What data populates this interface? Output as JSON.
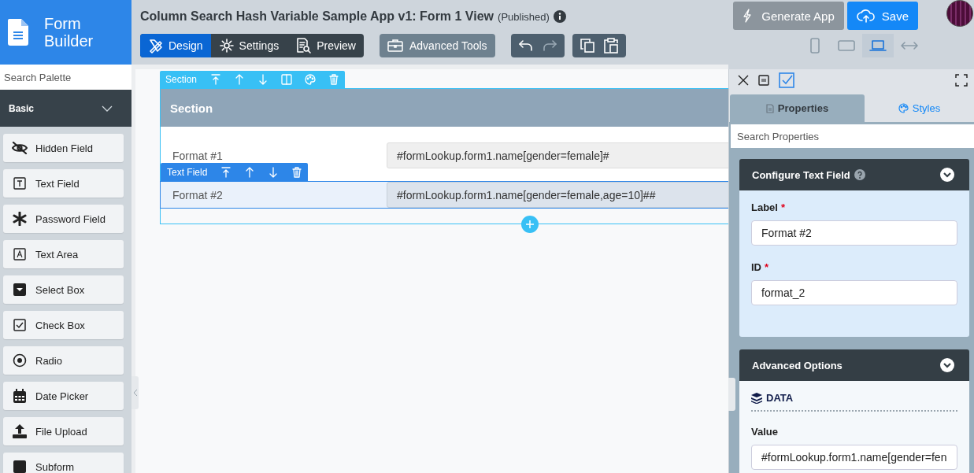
{
  "logo": {
    "title": "Form Builder"
  },
  "header": {
    "title": "Column Search Hash Variable Sample App v1: Form 1 View",
    "status": "(Published)"
  },
  "mode_tabs": [
    {
      "label": "Design",
      "kind": "design",
      "selected": true
    },
    {
      "label": "Settings",
      "kind": "settings",
      "selected": false
    },
    {
      "label": "Preview",
      "kind": "preview",
      "selected": false
    }
  ],
  "tools_button": {
    "label": "Advanced Tools"
  },
  "generate_button": {
    "label": "Generate App"
  },
  "save_button": {
    "label": "Save"
  },
  "devices": [
    {
      "kind": "phone",
      "selected": false
    },
    {
      "kind": "tablet",
      "selected": false
    },
    {
      "kind": "laptop",
      "selected": true
    },
    {
      "kind": "wide",
      "selected": false
    }
  ],
  "palette": {
    "search_placeholder": "Search Palette",
    "category": "Basic",
    "items": [
      {
        "label": "Hidden Field",
        "kind": "hidden"
      },
      {
        "label": "Text Field",
        "kind": "text"
      },
      {
        "label": "Password Field",
        "kind": "password"
      },
      {
        "label": "Text Area",
        "kind": "textarea"
      },
      {
        "label": "Select Box",
        "kind": "select"
      },
      {
        "label": "Check Box",
        "kind": "checkbox"
      },
      {
        "label": "Radio",
        "kind": "radio"
      },
      {
        "label": "Date Picker",
        "kind": "date"
      },
      {
        "label": "File Upload",
        "kind": "upload"
      },
      {
        "label": "Subform",
        "kind": "subform"
      }
    ]
  },
  "canvas": {
    "section_toolbar": {
      "label": "Section"
    },
    "section_title": "Section",
    "field_toolbar": {
      "label": "Text Field"
    },
    "fields": [
      {
        "label": "Format #1",
        "value": "#formLookup.form1.name[gender=female]#",
        "selected": false
      },
      {
        "label": "Format #2",
        "value": "#formLookup.form1.name[gender=female,age=10]##",
        "selected": true
      }
    ]
  },
  "properties": {
    "tabs": [
      {
        "label": "Properties",
        "kind": "properties",
        "selected": true
      },
      {
        "label": "Styles",
        "kind": "styles",
        "selected": false
      }
    ],
    "search_placeholder": "Search Properties",
    "config": {
      "title": "Configure Text Field",
      "fields": [
        {
          "label": "Label",
          "required_mark": "*",
          "value": "Format #2"
        },
        {
          "label": "ID",
          "required_mark": "*",
          "value": "format_2"
        }
      ]
    },
    "advanced": {
      "title": "Advanced Options",
      "group": "DATA",
      "fields": [
        {
          "label": "Value",
          "value": "#formLookup.form1.name[gender=fen"
        }
      ]
    }
  }
}
